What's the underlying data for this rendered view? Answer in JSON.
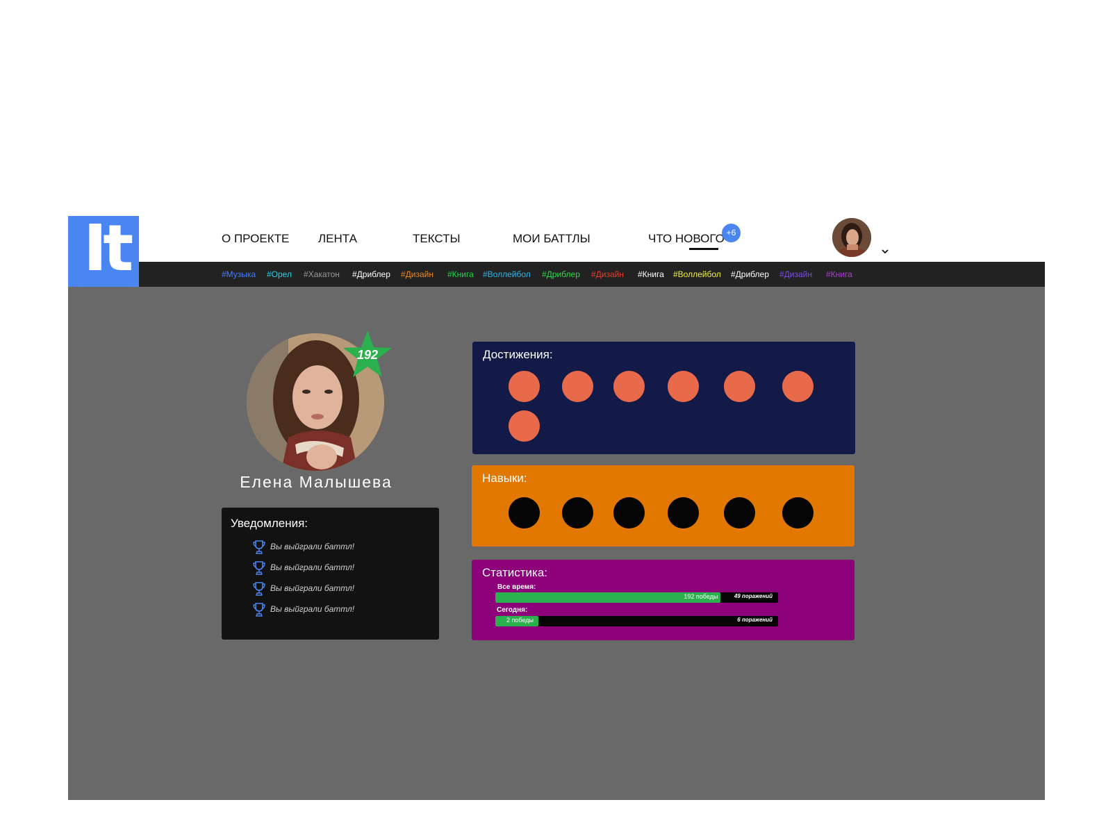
{
  "logo": {
    "text": "It"
  },
  "nav": {
    "items": [
      {
        "label": "О ПРОЕКТЕ"
      },
      {
        "label": "ЛЕНТА"
      },
      {
        "label": "ТЕКСТЫ"
      },
      {
        "label": "МОИ БАТТЛЫ"
      },
      {
        "label": "ЧТО НОВОГО"
      }
    ],
    "badge": "+6"
  },
  "tags": [
    {
      "label": "#Музыка",
      "color": "#4a7cff"
    },
    {
      "label": "#Орел",
      "color": "#21d4e8"
    },
    {
      "label": "#Хакатон",
      "color": "#9a9a9a"
    },
    {
      "label": "#Дриблер",
      "color": "#ffffff"
    },
    {
      "label": "#Дизайн",
      "color": "#f08a1c"
    },
    {
      "label": "#Книга",
      "color": "#1fd84a"
    },
    {
      "label": "#Воллейбол",
      "color": "#2ab8f0"
    },
    {
      "label": "#Дриблер",
      "color": "#2ed84a"
    },
    {
      "label": "#Дизайн",
      "color": "#f03c2c"
    },
    {
      "label": "#Книга",
      "color": "#ffffff"
    },
    {
      "label": "#Воллейбол",
      "color": "#f0f03c"
    },
    {
      "label": "#Дриблер",
      "color": "#ffffff"
    },
    {
      "label": "#Дизайн",
      "color": "#7a4cf0"
    },
    {
      "label": "#Книга",
      "color": "#b03cd8"
    }
  ],
  "profile": {
    "name": "Елена Малышева",
    "rating": "192"
  },
  "notifications": {
    "title": "Уведомления:",
    "items": [
      "Вы выйграли баттл!",
      "Вы выйграли баттл!",
      "Вы выйграли баттл!",
      "Вы выйграли баттл!"
    ]
  },
  "achievements": {
    "title": "Достижения:",
    "count": 7,
    "color": "#e96a4b"
  },
  "skills": {
    "title": "Навыки:",
    "count": 6
  },
  "stats": {
    "title": "Статистика:",
    "all_time": {
      "label": "Все время:",
      "wins": "192 победы",
      "losses": "49 поражений",
      "win_fraction": 0.797
    },
    "today": {
      "label": "Сегодня:",
      "wins": "2 победы",
      "losses": "6 поражений",
      "win_fraction": 0.153
    }
  },
  "colors": {
    "accent": "#4a86f2",
    "header_tag_bar": "#222222",
    "background": "#696969",
    "achievements_bg": "#141a48",
    "skills_bg": "#e27800",
    "stats_bg": "#8c0079",
    "win_bar": "#2bb04e",
    "rating_star": "#2bb04e"
  }
}
